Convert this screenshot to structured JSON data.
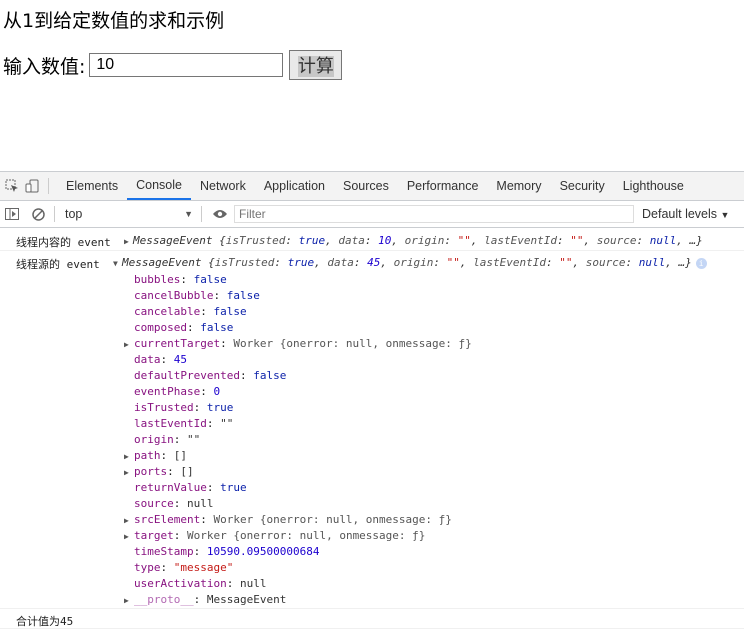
{
  "page": {
    "title": "从1到给定数值的求和示例",
    "input_label": "输入数值:",
    "input_value": "10",
    "button_label": "计算"
  },
  "devtools": {
    "tabs": [
      "Elements",
      "Console",
      "Network",
      "Application",
      "Sources",
      "Performance",
      "Memory",
      "Security",
      "Lighthouse"
    ],
    "active_tab": "Console",
    "toolbar": {
      "context": "top",
      "filter_placeholder": "Filter",
      "levels": "Default levels"
    },
    "messages": [
      {
        "prefix": "线程内容的 event",
        "type": "MessageEvent",
        "summary_data": "10"
      },
      {
        "prefix": "线程源的 event",
        "type": "MessageEvent",
        "summary_data": "45",
        "properties": [
          {
            "key": "bubbles",
            "value": "false",
            "kind": "kw"
          },
          {
            "key": "cancelBubble",
            "value": "false",
            "kind": "kw"
          },
          {
            "key": "cancelable",
            "value": "false",
            "kind": "kw"
          },
          {
            "key": "composed",
            "value": "false",
            "kind": "kw"
          },
          {
            "key": "currentTarget",
            "value": "Worker {onerror: null, onmessage: ƒ}",
            "kind": "obj",
            "expandable": true
          },
          {
            "key": "data",
            "value": "45",
            "kind": "num"
          },
          {
            "key": "defaultPrevented",
            "value": "false",
            "kind": "kw"
          },
          {
            "key": "eventPhase",
            "value": "0",
            "kind": "num"
          },
          {
            "key": "isTrusted",
            "value": "true",
            "kind": "kw"
          },
          {
            "key": "lastEventId",
            "value": "\"\"",
            "kind": "plain"
          },
          {
            "key": "origin",
            "value": "\"\"",
            "kind": "plain"
          },
          {
            "key": "path",
            "value": "[]",
            "kind": "plain",
            "expandable": true
          },
          {
            "key": "ports",
            "value": "[]",
            "kind": "plain",
            "expandable": true
          },
          {
            "key": "returnValue",
            "value": "true",
            "kind": "kw"
          },
          {
            "key": "source",
            "value": "null",
            "kind": "plain"
          },
          {
            "key": "srcElement",
            "value": "Worker {onerror: null, onmessage: ƒ}",
            "kind": "obj",
            "expandable": true
          },
          {
            "key": "target",
            "value": "Worker {onerror: null, onmessage: ƒ}",
            "kind": "obj",
            "expandable": true
          },
          {
            "key": "timeStamp",
            "value": "10590.09500000684",
            "kind": "num"
          },
          {
            "key": "type",
            "value": "\"message\"",
            "kind": "str"
          },
          {
            "key": "userActivation",
            "value": "null",
            "kind": "plain"
          },
          {
            "key": "__proto__",
            "value": "MessageEvent",
            "kind": "plain",
            "expandable": true,
            "dim": true
          }
        ]
      },
      {
        "prefix": "合计值为45"
      }
    ]
  }
}
